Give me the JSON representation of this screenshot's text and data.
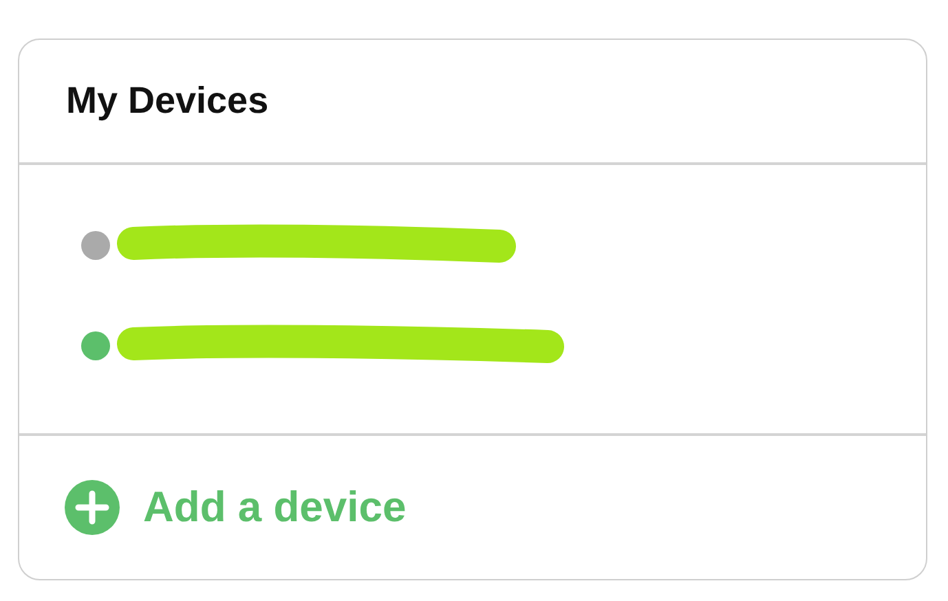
{
  "card": {
    "title": "My Devices"
  },
  "devices": [
    {
      "color": "#aaaaaa"
    },
    {
      "color": "#5cbf6b"
    }
  ],
  "footer": {
    "label": "Add a device"
  }
}
